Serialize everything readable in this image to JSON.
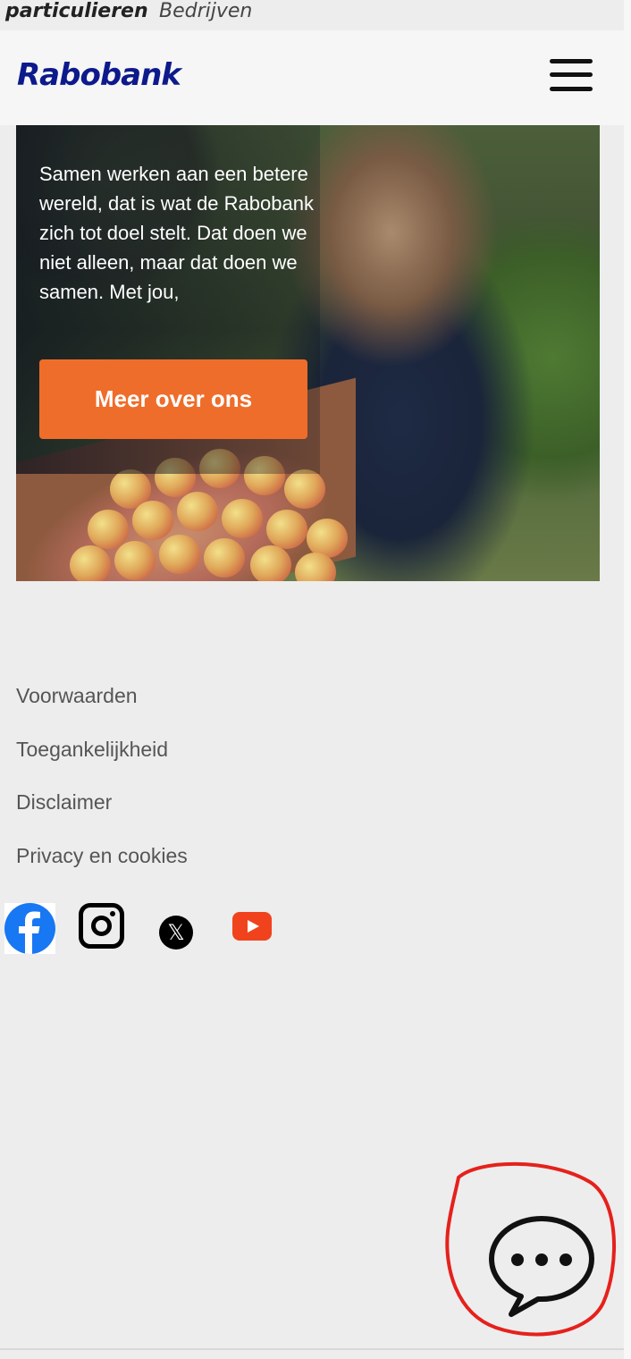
{
  "segments": {
    "active": "particulieren",
    "other": "Bedrijven"
  },
  "header": {
    "logo": "Rabobank",
    "menu_icon": "hamburger-menu-icon"
  },
  "hero": {
    "text": "Samen werken aan een betere wereld, dat is wat de Rabobank zich tot doel stelt. Dat doen we niet alleen, maar dat doen we samen. Met jou,",
    "cta_label": "Meer over ons",
    "cta_color": "#ef6d2a"
  },
  "footer": {
    "links": [
      "Voorwaarden",
      "Toegankelijkheid",
      "Disclaimer",
      "Privacy en cookies"
    ],
    "social_icons": [
      "facebook-icon",
      "instagram-icon",
      "x-icon",
      "youtube-icon"
    ]
  },
  "chat": {
    "icon": "chat-bubble-icon",
    "annotation_color": "#e5211c"
  },
  "colors": {
    "brand": "#0d1a8c",
    "accent": "#ef6d2a",
    "background": "#ededed"
  }
}
